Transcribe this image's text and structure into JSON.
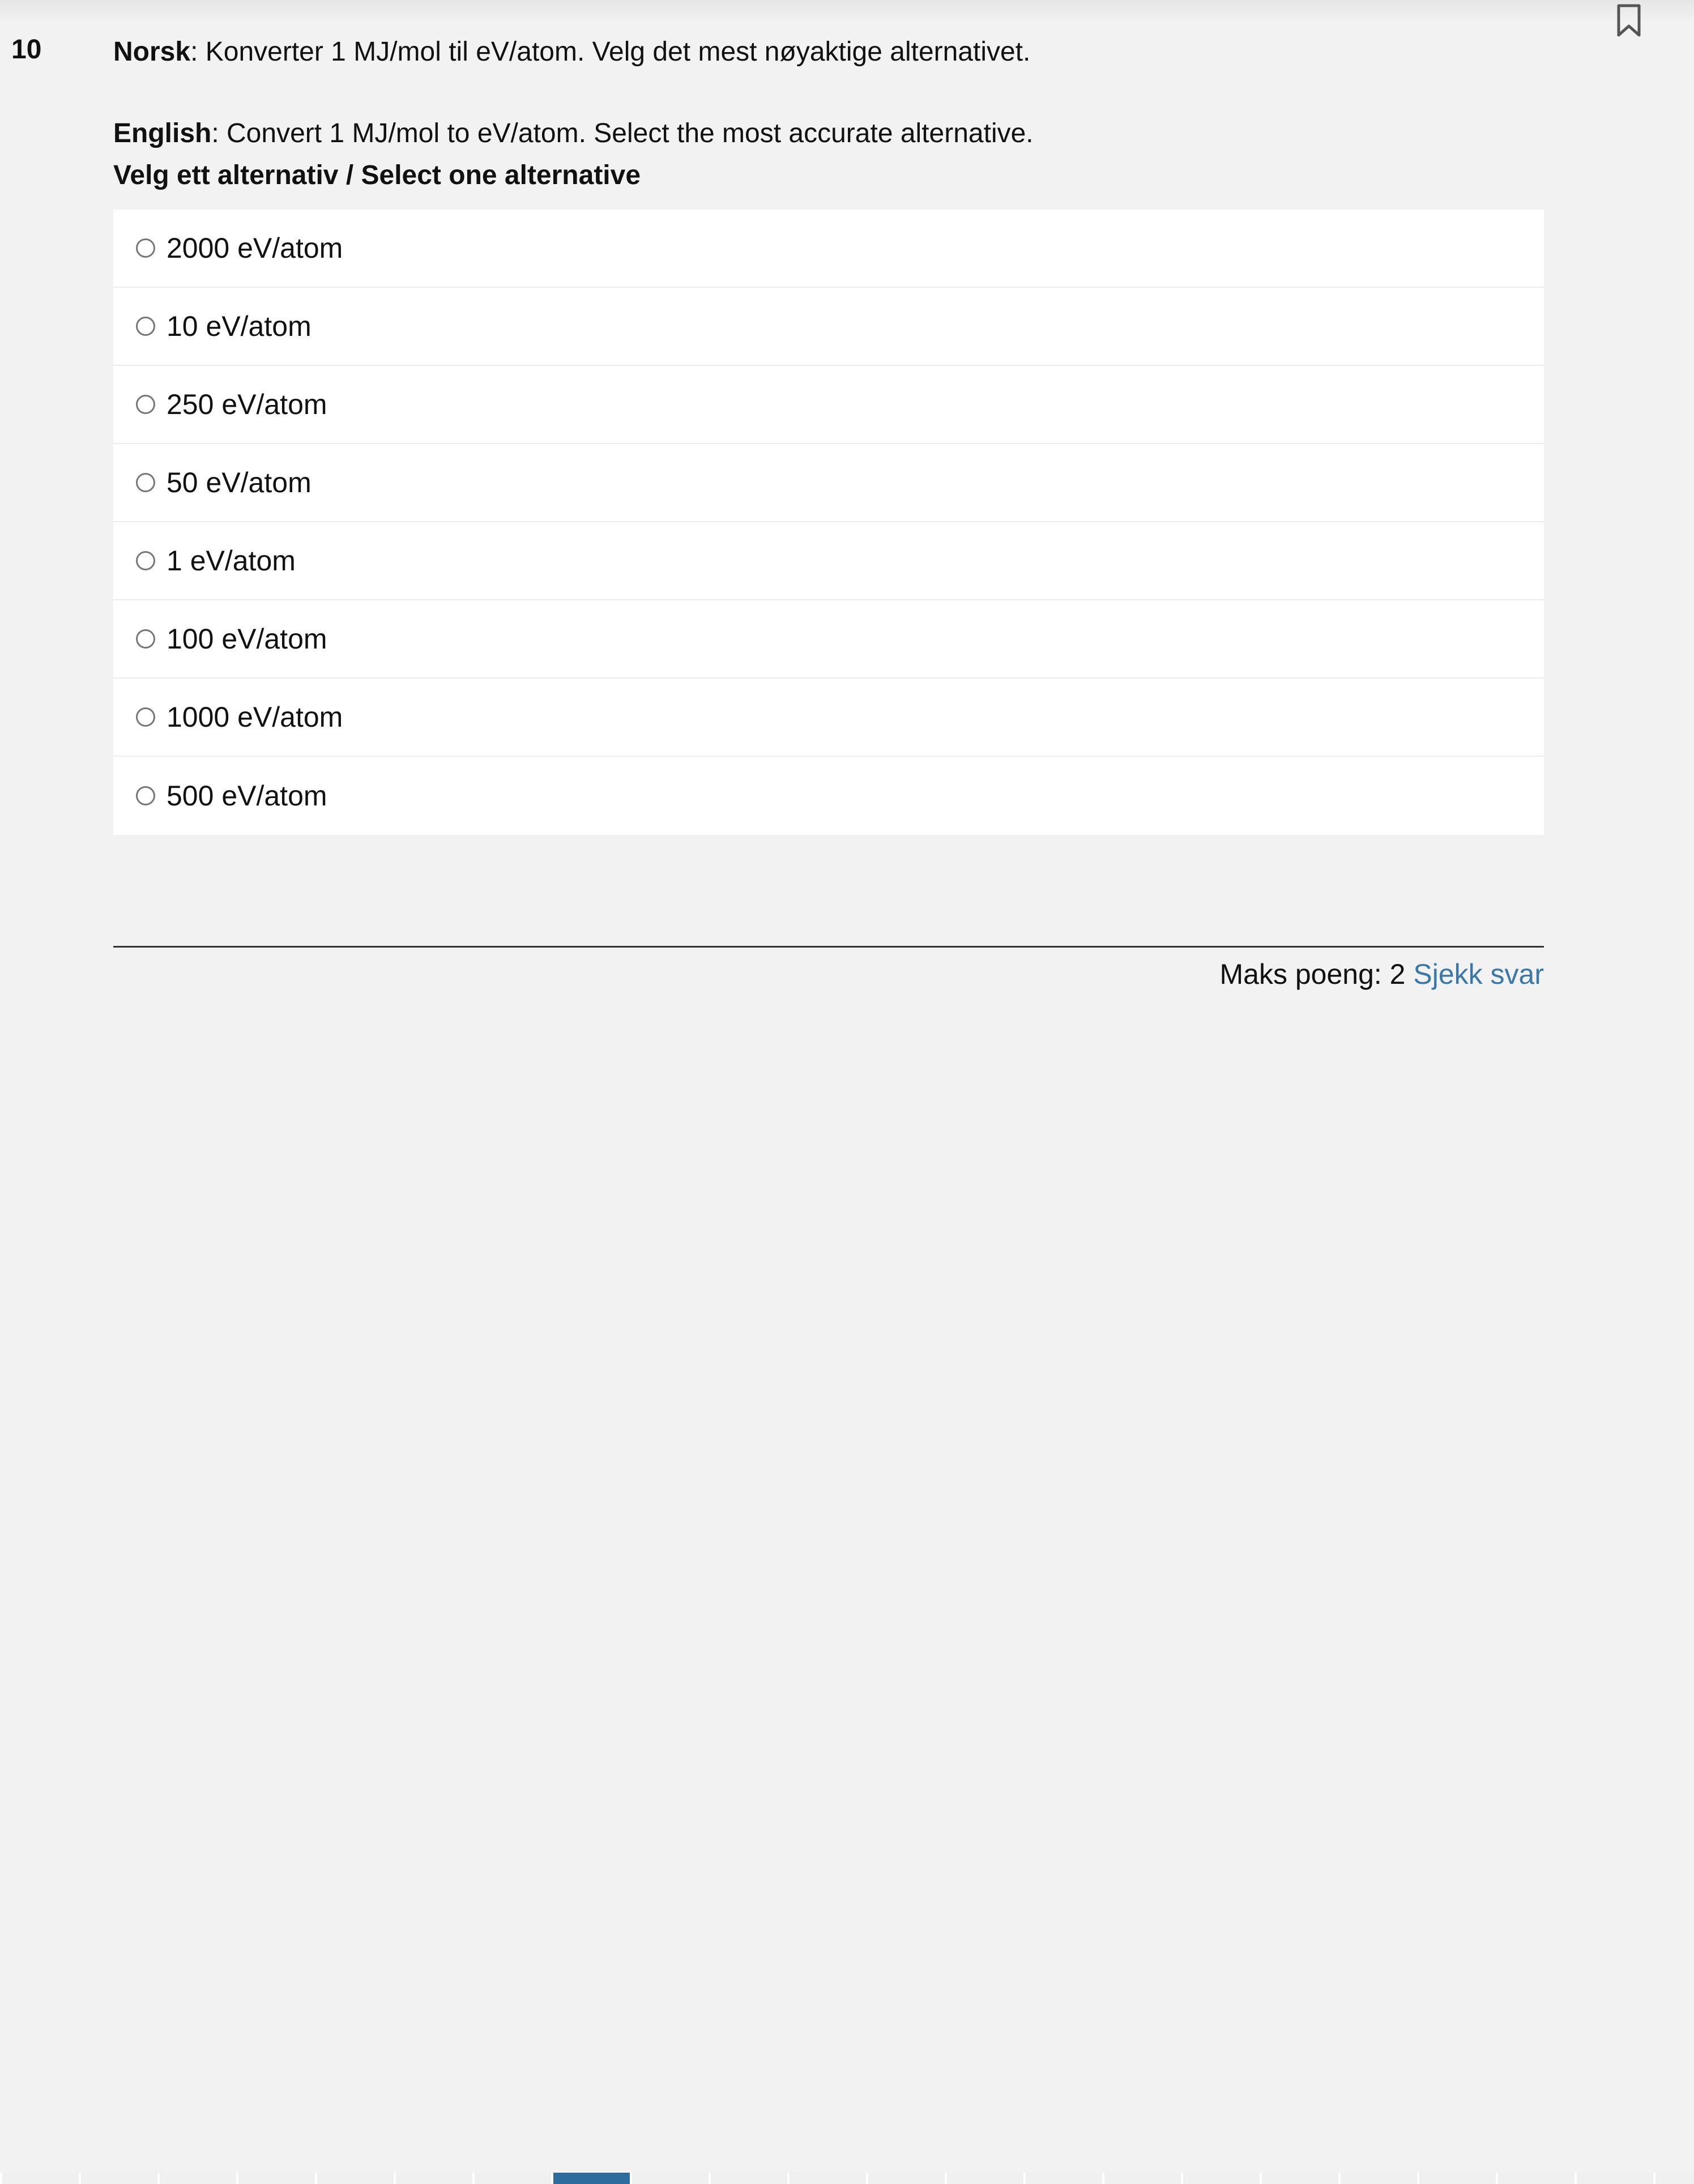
{
  "question": {
    "number": "10",
    "norsk_label": "Norsk",
    "norsk_text": ": Konverter 1 MJ/mol til eV/atom. Velg det mest nøyaktige alternativet.",
    "english_label": "English",
    "english_text": ": Convert 1 MJ/mol to eV/atom. Select the most accurate alternative.",
    "instruction": "Velg ett alternativ / Select one alternative",
    "options": [
      "2000 eV/atom",
      "10 eV/atom",
      "250 eV/atom",
      "50 eV/atom",
      "1 eV/atom",
      "100 eV/atom",
      "1000 eV/atom",
      "500 eV/atom"
    ]
  },
  "footer": {
    "max_points_label": "Maks poeng: 2",
    "check_answer_label": "Sjekk svar"
  },
  "icons": {
    "bookmark": "bookmark-icon",
    "radio": "radio-button"
  },
  "colors": {
    "background": "#f2f2f2",
    "link": "#3a78a8",
    "nav_active": "#2e6c9e"
  },
  "navigation": {
    "active_index": 7
  }
}
